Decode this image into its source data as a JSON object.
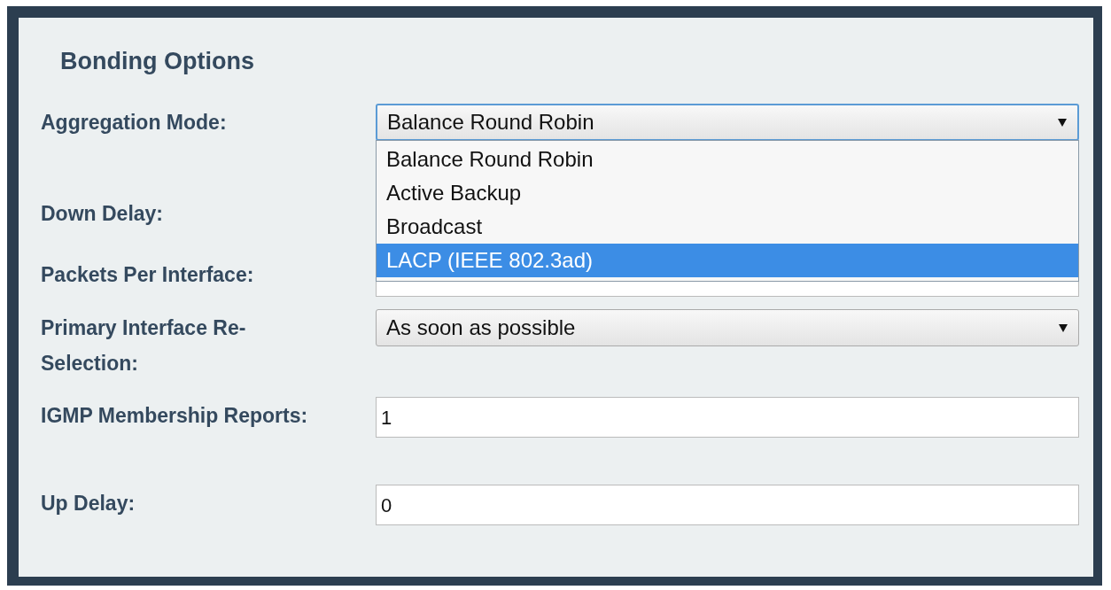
{
  "title": "Bonding Options",
  "fields": [
    {
      "label": "Aggregation Mode:",
      "kind": "select",
      "value": "Balance Round Robin",
      "expanded": true,
      "options": [
        {
          "label": "Balance Round Robin",
          "highlighted": false
        },
        {
          "label": "Active Backup",
          "highlighted": false
        },
        {
          "label": "Broadcast",
          "highlighted": false
        },
        {
          "label": "LACP (IEEE 802.3ad)",
          "highlighted": true
        }
      ]
    },
    {
      "label": "Down Delay:"
    },
    {
      "label": "Packets Per Interface:",
      "kind": "input"
    },
    {
      "label": "Primary Interface Re-Selection:",
      "kind": "select",
      "value": "As soon as possible",
      "expanded": false
    },
    {
      "label": "IGMP Membership Reports:",
      "kind": "input",
      "value": "1"
    },
    {
      "label": "Up Delay:",
      "kind": "input",
      "value": "0"
    }
  ]
}
